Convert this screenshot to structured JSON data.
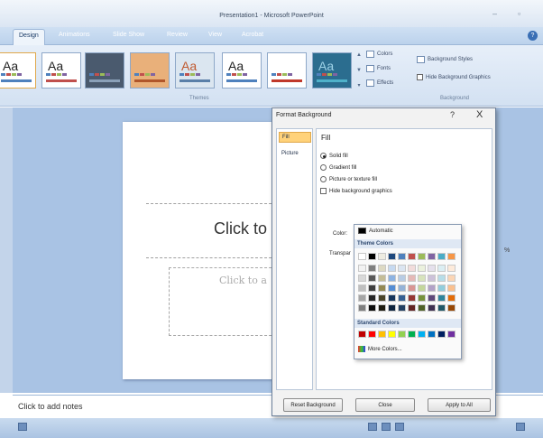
{
  "window": {
    "title": "Presentation1 - Microsoft PowerPoint"
  },
  "ribbon": {
    "tabs": [
      "Design",
      "Animations",
      "Slide Show",
      "Review",
      "View",
      "Acrobat"
    ],
    "active_tab": "Design",
    "themes": [
      {
        "label": "Aa",
        "sub": "Office Theme",
        "bg": "#ffffff",
        "fg": "#222222",
        "bar": "#4f81bd"
      },
      {
        "label": "Aa",
        "sub": "Apex",
        "bg": "#ffffff",
        "fg": "#222222",
        "bar": "#c0504d"
      },
      {
        "label": "",
        "sub": "",
        "bg": "#4a5a6e",
        "fg": "#dddddd",
        "bar": "#8aa0b8"
      },
      {
        "label": "",
        "sub": "",
        "bg": "#e9b07a",
        "fg": "#ffffff",
        "bar": "#b0562a"
      },
      {
        "label": "Aa",
        "sub": "",
        "bg": "#dbe6f0",
        "fg": "#c05a30",
        "bar": "#5a7fa8"
      },
      {
        "label": "Aa",
        "sub": "",
        "bg": "#ffffff",
        "fg": "#222222",
        "bar": "#4f81bd"
      },
      {
        "label": "",
        "sub": "",
        "bg": "#ffffff",
        "fg": "#222222",
        "bar": "#c0392b"
      },
      {
        "label": "Aa",
        "sub": "",
        "bg": "#2b6d8f",
        "fg": "#9fd3e8",
        "bar": "#4fb1c9"
      }
    ],
    "themes_group_label": "Themes",
    "colors_label": "Colors",
    "fonts_label": "Fonts",
    "effects_label": "Effects",
    "background_styles_label": "Background Styles",
    "hide_background_label": "Hide Background Graphics",
    "background_group_label": "Background"
  },
  "slide": {
    "title_placeholder": "Click to",
    "subtitle_placeholder": "Click to a"
  },
  "notes": {
    "placeholder": "Click to add notes"
  },
  "dialog": {
    "title": "Format Background",
    "help": "?",
    "close": "X",
    "categories": [
      "Fill",
      "Picture"
    ],
    "selected_category": "Fill",
    "section": "Fill",
    "options": [
      {
        "label": "Solid fill",
        "type": "radio",
        "checked": true
      },
      {
        "label": "Gradient fill",
        "type": "radio",
        "checked": false
      },
      {
        "label": "Picture or texture fill",
        "type": "radio",
        "checked": false
      },
      {
        "label": "Hide background graphics",
        "type": "check",
        "checked": false
      }
    ],
    "color_label": "Color:",
    "transparency_label": "Transpar",
    "buttons": {
      "reset": "Reset Background",
      "close": "Close",
      "apply_all": "Apply to All"
    }
  },
  "color_picker": {
    "automatic_label": "Automatic",
    "theme_colors_label": "Theme Colors",
    "standard_colors_label": "Standard Colors",
    "more_colors_label": "More Colors...",
    "theme_base": [
      "#ffffff",
      "#000000",
      "#eeece1",
      "#1f497d",
      "#4f81bd",
      "#c0504d",
      "#9bbb59",
      "#8064a2",
      "#4bacc6",
      "#f79646"
    ],
    "theme_shades": [
      [
        "#f2f2f2",
        "#7f7f7f",
        "#ddd9c3",
        "#c6d9f0",
        "#dbe5f1",
        "#f2dcdb",
        "#ebf1dd",
        "#e5e0ec",
        "#dbeef3",
        "#fdeada"
      ],
      [
        "#d8d8d8",
        "#595959",
        "#c4bd97",
        "#8db3e2",
        "#b8cce4",
        "#e5b9b7",
        "#d7e3bc",
        "#ccc1d9",
        "#b7dde8",
        "#fbd5b5"
      ],
      [
        "#bfbfbf",
        "#3f3f3f",
        "#938953",
        "#548dd4",
        "#95b3d7",
        "#d99694",
        "#c3d69b",
        "#b2a2c7",
        "#92cddc",
        "#fac08f"
      ],
      [
        "#a5a5a5",
        "#262626",
        "#494429",
        "#17365d",
        "#366092",
        "#953734",
        "#76923c",
        "#5f497a",
        "#31859b",
        "#e36c09"
      ],
      [
        "#7f7f7f",
        "#0c0c0c",
        "#1d1b10",
        "#0f243e",
        "#244061",
        "#632423",
        "#4f6128",
        "#3f3151",
        "#205867",
        "#974806"
      ]
    ],
    "standard": [
      "#c00000",
      "#ff0000",
      "#ffc000",
      "#ffff00",
      "#92d050",
      "#00b050",
      "#00b0f0",
      "#0070c0",
      "#002060",
      "#7030a0"
    ]
  }
}
